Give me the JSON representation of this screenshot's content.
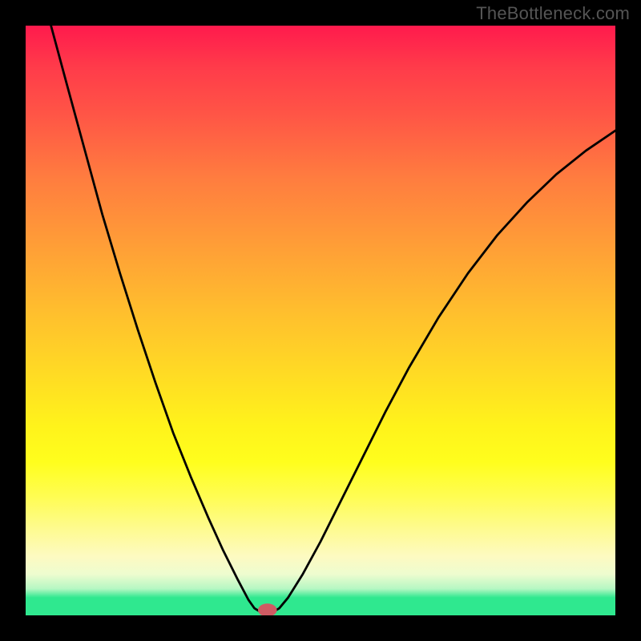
{
  "watermark": "TheBottleneck.com",
  "chart_data": {
    "type": "line",
    "title": "",
    "xlabel": "",
    "ylabel": "",
    "xlim": [
      0,
      100
    ],
    "ylim": [
      0,
      100
    ],
    "background_gradient": {
      "stops": [
        {
          "pos": 0,
          "color": "#ff1a4d"
        },
        {
          "pos": 15,
          "color": "#ff5546"
        },
        {
          "pos": 37,
          "color": "#ff9d37"
        },
        {
          "pos": 58,
          "color": "#ffd825"
        },
        {
          "pos": 74,
          "color": "#fffe1d"
        },
        {
          "pos": 90,
          "color": "#fdfac1"
        },
        {
          "pos": 97,
          "color": "#2fe88f"
        },
        {
          "pos": 100,
          "color": "#2fe88f"
        }
      ]
    },
    "series": [
      {
        "name": "bottleneck-curve",
        "color": "#000000",
        "points": [
          {
            "x": 4.3,
            "y": 100
          },
          {
            "x": 7,
            "y": 90
          },
          {
            "x": 10,
            "y": 79
          },
          {
            "x": 13,
            "y": 68
          },
          {
            "x": 16,
            "y": 58
          },
          {
            "x": 19,
            "y": 48.5
          },
          {
            "x": 22,
            "y": 39.5
          },
          {
            "x": 25,
            "y": 31
          },
          {
            "x": 28,
            "y": 23.5
          },
          {
            "x": 31,
            "y": 16.5
          },
          {
            "x": 33.5,
            "y": 11
          },
          {
            "x": 36,
            "y": 6
          },
          {
            "x": 37.8,
            "y": 2.6
          },
          {
            "x": 38.8,
            "y": 1.2
          },
          {
            "x": 39.8,
            "y": 0.6
          },
          {
            "x": 41.2,
            "y": 0.6
          },
          {
            "x": 42,
            "y": 0.6
          },
          {
            "x": 43,
            "y": 1.2
          },
          {
            "x": 44.5,
            "y": 3
          },
          {
            "x": 47,
            "y": 7
          },
          {
            "x": 50,
            "y": 12.5
          },
          {
            "x": 53,
            "y": 18.5
          },
          {
            "x": 57,
            "y": 26.5
          },
          {
            "x": 61,
            "y": 34.5
          },
          {
            "x": 65,
            "y": 42
          },
          {
            "x": 70,
            "y": 50.5
          },
          {
            "x": 75,
            "y": 58
          },
          {
            "x": 80,
            "y": 64.5
          },
          {
            "x": 85,
            "y": 70
          },
          {
            "x": 90,
            "y": 74.8
          },
          {
            "x": 95,
            "y": 78.8
          },
          {
            "x": 100,
            "y": 82.2
          }
        ]
      }
    ],
    "marker": {
      "x": 41,
      "y": 0.9,
      "rx": 1.6,
      "ry": 1.1,
      "color": "#cf5b63"
    }
  }
}
